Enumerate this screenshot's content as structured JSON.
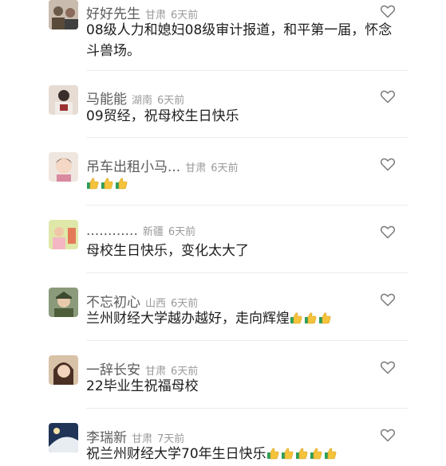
{
  "comments": [
    {
      "nick": "好好先生",
      "region": "甘肃",
      "time": "6天前",
      "text": "08级人力和媳妇08级审计报道，和平第一届，怀念斗兽场。",
      "thumbs": 0,
      "avatar_color": "#8a7a6a"
    },
    {
      "nick": "马能能",
      "region": "湖南",
      "time": "6天前",
      "text": "09贸经，祝母校生日快乐",
      "thumbs": 0,
      "avatar_color": "#b9a596"
    },
    {
      "nick": "吊车出租小马...",
      "region": "甘肃",
      "time": "6天前",
      "text": "",
      "thumbs": 3,
      "avatar_color": "#d9c9c0"
    },
    {
      "nick": "............",
      "region": "新疆",
      "time": "6天前",
      "text": "母校生日快乐，变化太大了",
      "thumbs": 0,
      "avatar_color": "#c8d48a"
    },
    {
      "nick": "不忘初心",
      "region": "山西",
      "time": "6天前",
      "text": "兰州财经大学越办越好，走向辉煌",
      "thumbs": 3,
      "avatar_color": "#5d6a4c"
    },
    {
      "nick": "一辞长安",
      "region": "甘肃",
      "time": "6天前",
      "text": "22毕业生祝福母校",
      "thumbs": 0,
      "avatar_color": "#6b4c3b"
    },
    {
      "nick": "李瑞新",
      "region": "甘肃",
      "time": "7天前",
      "text": "祝兰州财经大学70年生日快乐",
      "thumbs": 5,
      "avatar_color": "#2e4a6e"
    }
  ]
}
